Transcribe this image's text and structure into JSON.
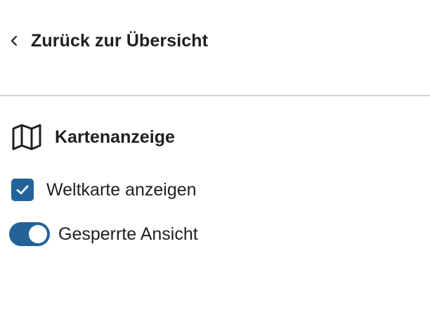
{
  "nav": {
    "back_label": "Zurück zur Übersicht",
    "back_icon": "chevron-left-icon"
  },
  "section": {
    "title": "Kartenanzeige",
    "icon": "map-icon"
  },
  "options": {
    "world_map": {
      "label": "Weltkarte anzeigen",
      "type": "checkbox",
      "checked": true
    },
    "locked_view": {
      "label": "Gesperrte Ansicht",
      "type": "toggle",
      "on": true
    }
  },
  "colors": {
    "accent": "#23639a",
    "text": "#1f1f1f",
    "divider": "#d4d4d4",
    "background": "#ffffff"
  }
}
